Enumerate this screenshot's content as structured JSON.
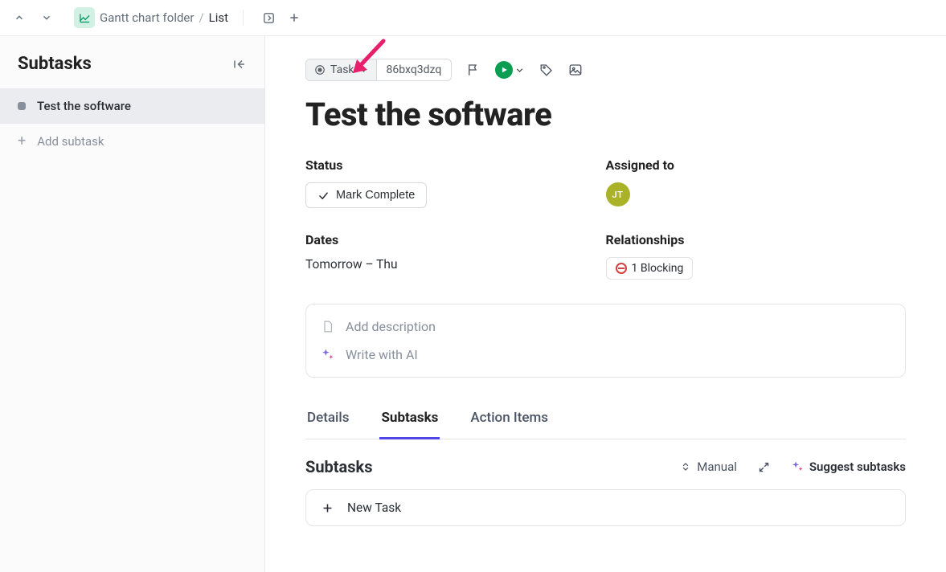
{
  "breadcrumb": {
    "folder": "Gantt chart folder",
    "sep": "/",
    "current": "List"
  },
  "sidebar": {
    "title": "Subtasks",
    "items": [
      {
        "label": "Test the software"
      }
    ],
    "add_label": "Add subtask"
  },
  "toolbar": {
    "type_label": "Task",
    "task_id": "86bxq3dzq"
  },
  "task": {
    "title": "Test the software",
    "fields": {
      "status_label": "Status",
      "status_action": "Mark Complete",
      "assigned_label": "Assigned to",
      "assignee_initials": "JT",
      "dates_label": "Dates",
      "dates_value": "Tomorrow – Thu",
      "relationships_label": "Relationships",
      "blocking_text": "1 Blocking"
    },
    "desc": {
      "add": "Add description",
      "ai": "Write with AI"
    },
    "tabs": {
      "details": "Details",
      "subtasks": "Subtasks",
      "action_items": "Action Items"
    },
    "subtasks": {
      "heading": "Subtasks",
      "sort": "Manual",
      "suggest": "Suggest subtasks",
      "new_task": "New Task"
    }
  }
}
